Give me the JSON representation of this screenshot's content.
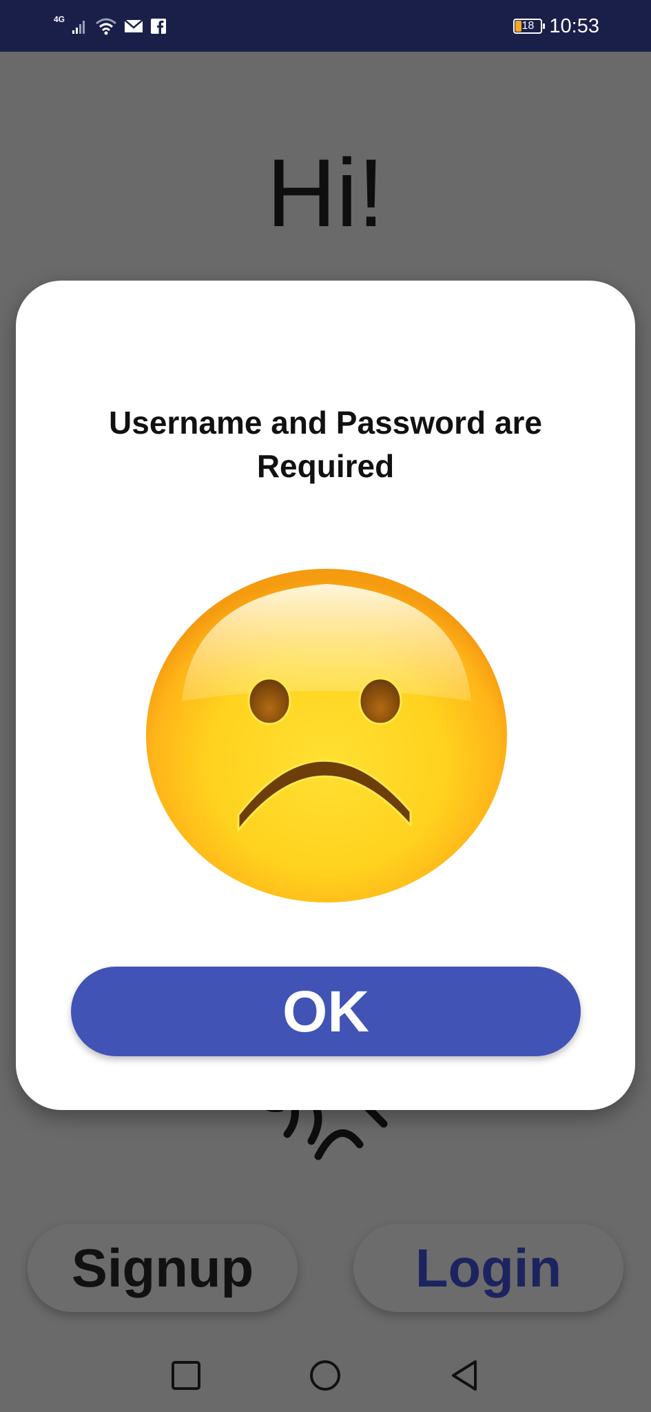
{
  "status_bar": {
    "network_type": "4G",
    "battery_level": "18",
    "time": "10:53",
    "icons": [
      "signal-icon",
      "wifi-icon",
      "mail-icon",
      "facebook-icon",
      "battery-icon"
    ]
  },
  "background": {
    "greeting": "Hi!",
    "signup_label": "Signup",
    "login_label": "Login"
  },
  "dialog": {
    "message": "Username and Password are Required",
    "icon": "sad-face-icon",
    "ok_label": "OK"
  },
  "nav_bar": {
    "icons": [
      "recent-apps-icon",
      "home-icon",
      "back-icon"
    ]
  },
  "colors": {
    "status_bar": "#1a1f4a",
    "overlay_background": "#6a6a6a",
    "ok_button": "#4253b6",
    "login_text": "#1c2460",
    "battery_fill": "#f5a623"
  }
}
